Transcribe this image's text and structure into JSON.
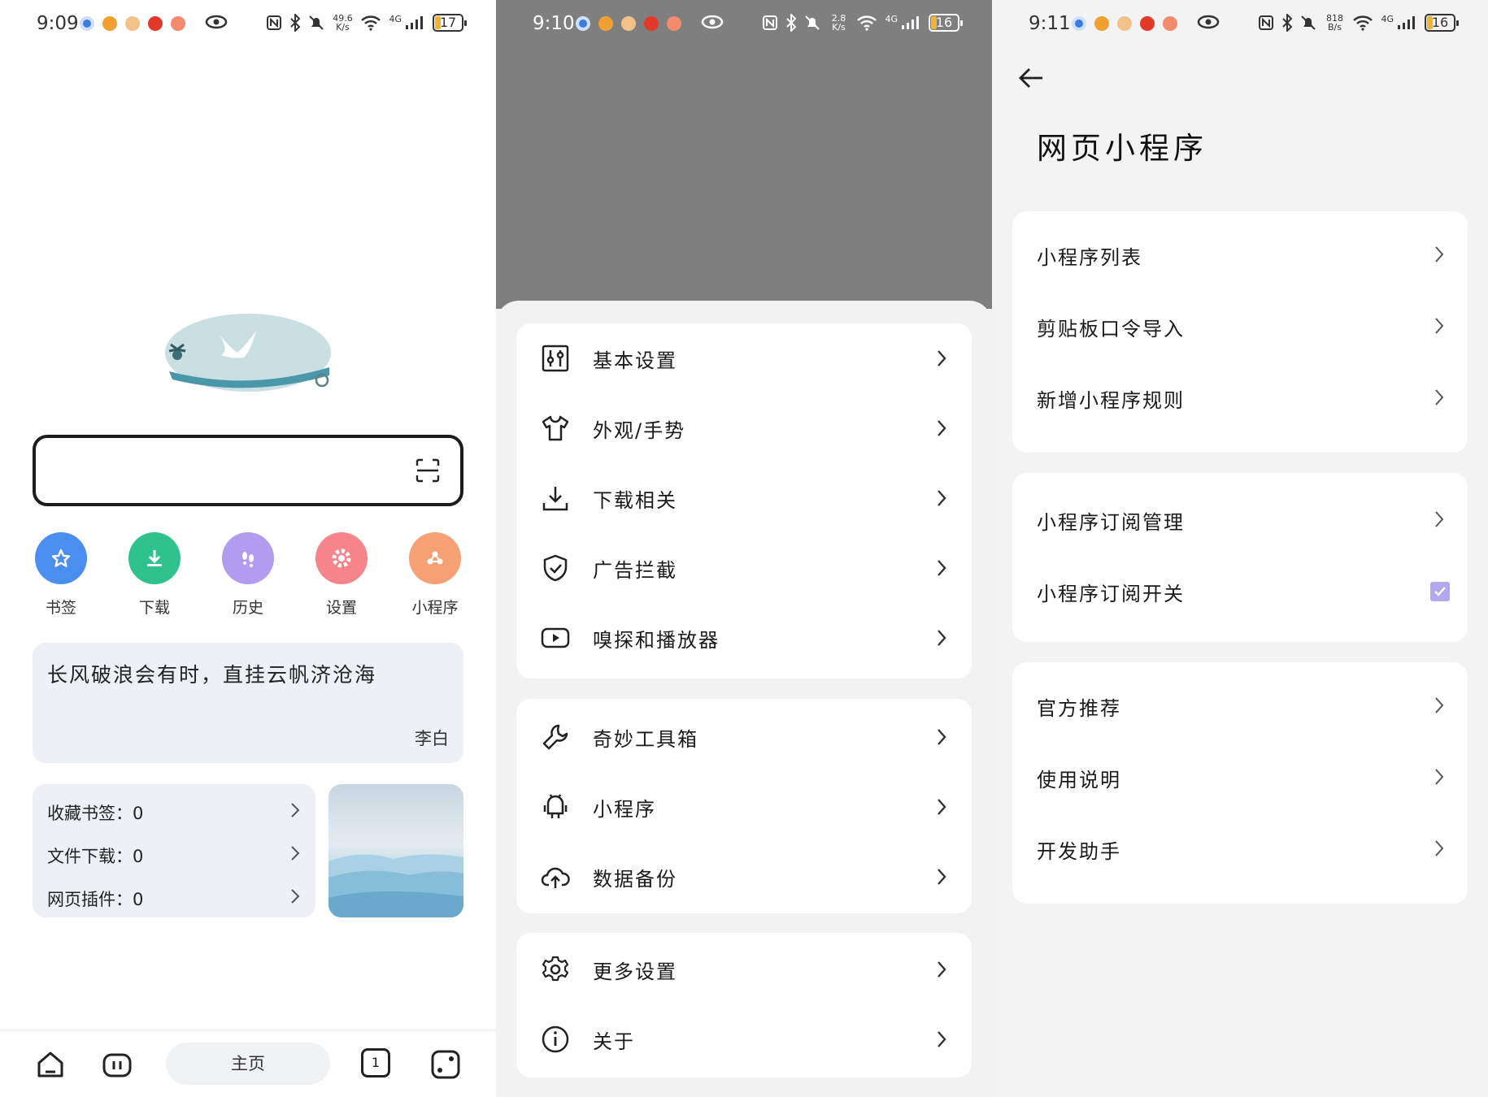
{
  "panel1": {
    "status": {
      "time": "9:09",
      "speed_top": "49.6",
      "speed_unit": "K/s",
      "network": "4G",
      "battery": "17"
    },
    "shortcuts": [
      {
        "label": "书签",
        "color": "#4a8ff0",
        "icon": "star-icon"
      },
      {
        "label": "下载",
        "color": "#2fc28c",
        "icon": "download-icon"
      },
      {
        "label": "历史",
        "color": "#b29cf0",
        "icon": "footprints-icon"
      },
      {
        "label": "设置",
        "color": "#f5858a",
        "icon": "gear-icon"
      },
      {
        "label": "小程序",
        "color": "#f5a075",
        "icon": "mini-program-icon"
      }
    ],
    "quote": {
      "text": "长风破浪会有时，直挂云帆济沧海",
      "author": "李白"
    },
    "stats": [
      "收藏书签：0",
      "文件下载：0",
      "网页插件：0"
    ],
    "bottom_nav": {
      "home_label": "主页",
      "tab_count": "1"
    }
  },
  "panel2": {
    "status": {
      "time": "9:10",
      "speed_top": "2.8",
      "speed_unit": "K/s",
      "network": "4G",
      "battery": "16"
    },
    "groups": [
      [
        {
          "label": "基本设置",
          "icon": "sliders-icon"
        },
        {
          "label": "外观/手势",
          "icon": "tshirt-icon"
        },
        {
          "label": "下载相关",
          "icon": "download-icon"
        },
        {
          "label": "广告拦截",
          "icon": "shield-check-icon"
        },
        {
          "label": "嗅探和播放器",
          "icon": "play-icon"
        }
      ],
      [
        {
          "label": "奇妙工具箱",
          "icon": "wrench-icon"
        },
        {
          "label": "小程序",
          "icon": "android-icon"
        },
        {
          "label": "数据备份",
          "icon": "cloud-upload-icon"
        }
      ],
      [
        {
          "label": "更多设置",
          "icon": "gear-icon"
        },
        {
          "label": "关于",
          "icon": "info-icon"
        }
      ]
    ]
  },
  "panel3": {
    "status": {
      "time": "9:11",
      "speed_top": "818",
      "speed_unit": "B/s",
      "network": "4G",
      "battery": "16"
    },
    "title": "网页小程序",
    "groups": [
      [
        "小程序列表",
        "剪贴板口令导入",
        "新增小程序规则"
      ],
      [
        "小程序订阅管理",
        "小程序订阅开关"
      ],
      [
        "官方推荐",
        "使用说明",
        "开发助手"
      ]
    ],
    "checkbox_checked": true
  },
  "colors": {
    "accent": "#b2a8ee",
    "dim_overlay": "#7f7f7f",
    "card_bg": "#edf0f4"
  }
}
